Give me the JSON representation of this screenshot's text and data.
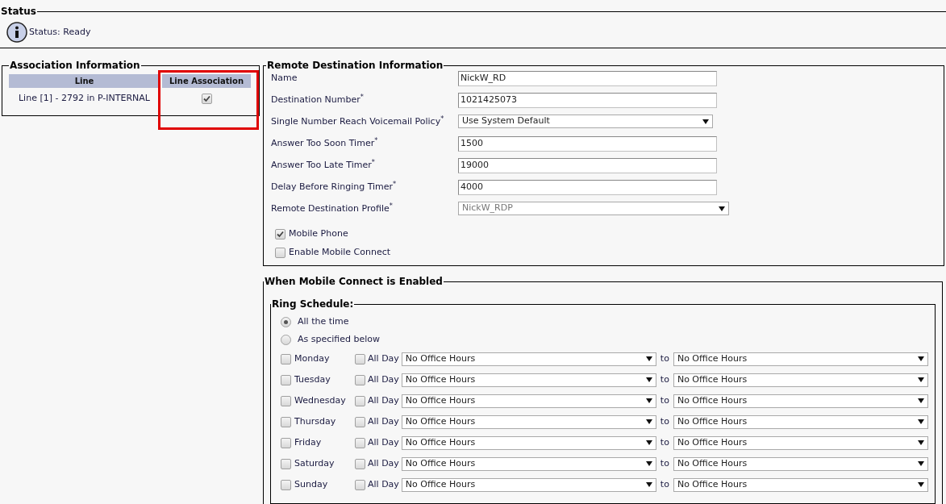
{
  "status": {
    "legend": "Status",
    "message": "Status: Ready"
  },
  "association": {
    "legend": "Association Information",
    "columns": [
      {
        "label": "Line",
        "highlighted": false
      },
      {
        "label": "Line Association",
        "highlighted": true
      }
    ],
    "rows": [
      {
        "line": "Line [1] - 2792 in P-INTERNAL",
        "checked": true
      }
    ]
  },
  "remote_destination": {
    "legend": "Remote Destination Information",
    "fields": [
      {
        "kind": "text",
        "label": "Name",
        "value": "NickW_RD"
      },
      {
        "kind": "text",
        "label": "Destination Number$^{*}$",
        "value": "1021425073"
      },
      {
        "kind": "select",
        "label": "Single Number Reach Voicemail Policy$^{*}$",
        "value": "Use System Default",
        "disabled": false
      },
      {
        "kind": "text",
        "label": "Answer Too Soon Timer$^{*}$",
        "value": "1500"
      },
      {
        "kind": "text",
        "label": "Answer Too Late Timer$^{*}$",
        "value": "19000"
      },
      {
        "kind": "text",
        "label": "Delay Before Ringing Timer$^{*}$",
        "value": "4000"
      },
      {
        "kind": "select",
        "label": "Remote Destination Profile$^{*}$",
        "value": "NickW_RDP",
        "disabled": true
      }
    ],
    "checkboxes": [
      {
        "label": "Mobile Phone",
        "checked": true
      },
      {
        "label": "Enable Mobile Connect",
        "checked": false
      }
    ]
  },
  "mobile_connect": {
    "legend": "When Mobile Connect is Enabled",
    "ring_schedule": {
      "legend": "Ring Schedule:",
      "options": [
        {
          "label": "All the time",
          "selected": true
        },
        {
          "label": "As specified below",
          "selected": false
        }
      ],
      "days": [
        {
          "day": "Monday",
          "checked": false,
          "all_day_label": "All Day",
          "all_day": false,
          "from": "No Office Hours",
          "to_label": "to",
          "to": "No Office Hours"
        },
        {
          "day": "Tuesday",
          "checked": false,
          "all_day_label": "All Day",
          "all_day": false,
          "from": "No Office Hours",
          "to_label": "to",
          "to": "No Office Hours"
        },
        {
          "day": "Wednesday",
          "checked": false,
          "all_day_label": "All Day",
          "all_day": false,
          "from": "No Office Hours",
          "to_label": "to",
          "to": "No Office Hours"
        },
        {
          "day": "Thursday",
          "checked": false,
          "all_day_label": "All Day",
          "all_day": false,
          "from": "No Office Hours",
          "to_label": "to",
          "to": "No Office Hours"
        },
        {
          "day": "Friday",
          "checked": false,
          "all_day_label": "All Day",
          "all_day": false,
          "from": "No Office Hours",
          "to_label": "to",
          "to": "No Office Hours"
        },
        {
          "day": "Saturday",
          "checked": false,
          "all_day_label": "All Day",
          "all_day": false,
          "from": "No Office Hours",
          "to_label": "to",
          "to": "No Office Hours"
        },
        {
          "day": "Sunday",
          "checked": false,
          "all_day_label": "All Day",
          "all_day": false,
          "from": "No Office Hours",
          "to_label": "to",
          "to": "No Office Hours"
        }
      ]
    }
  }
}
